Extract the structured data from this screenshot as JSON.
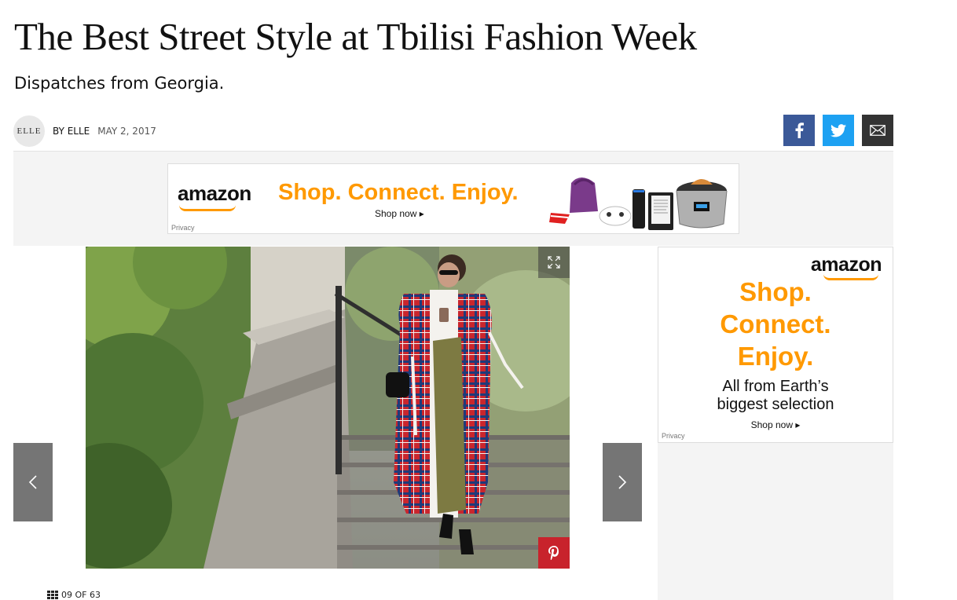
{
  "article": {
    "title": "The Best Street Style at Tbilisi Fashion Week",
    "dek": "Dispatches from Georgia.",
    "author_logo": "ELLE",
    "byline": "BY ELLE",
    "date": "MAY 2, 2017"
  },
  "share": {
    "icons": [
      "facebook-icon",
      "twitter-icon",
      "email-icon"
    ]
  },
  "banner_ad": {
    "brand": "amazon",
    "headline": "Shop. Connect. Enjoy.",
    "cta": "Shop now ▸",
    "privacy": "Privacy"
  },
  "side_ad": {
    "brand": "amazon",
    "headline_lines": [
      "Shop.",
      "Connect.",
      "Enjoy."
    ],
    "tagline_lines": [
      "All from Earth’s",
      "biggest selection"
    ],
    "cta": "Shop now ▸",
    "privacy": "Privacy"
  },
  "gallery": {
    "counter": "09 OF 63",
    "current": 9,
    "total": 63
  },
  "colors": {
    "facebook": "#3b5998",
    "twitter": "#1da1f2",
    "email": "#333333",
    "pinterest": "#c8232c",
    "amazon_orange": "#ff9900"
  }
}
